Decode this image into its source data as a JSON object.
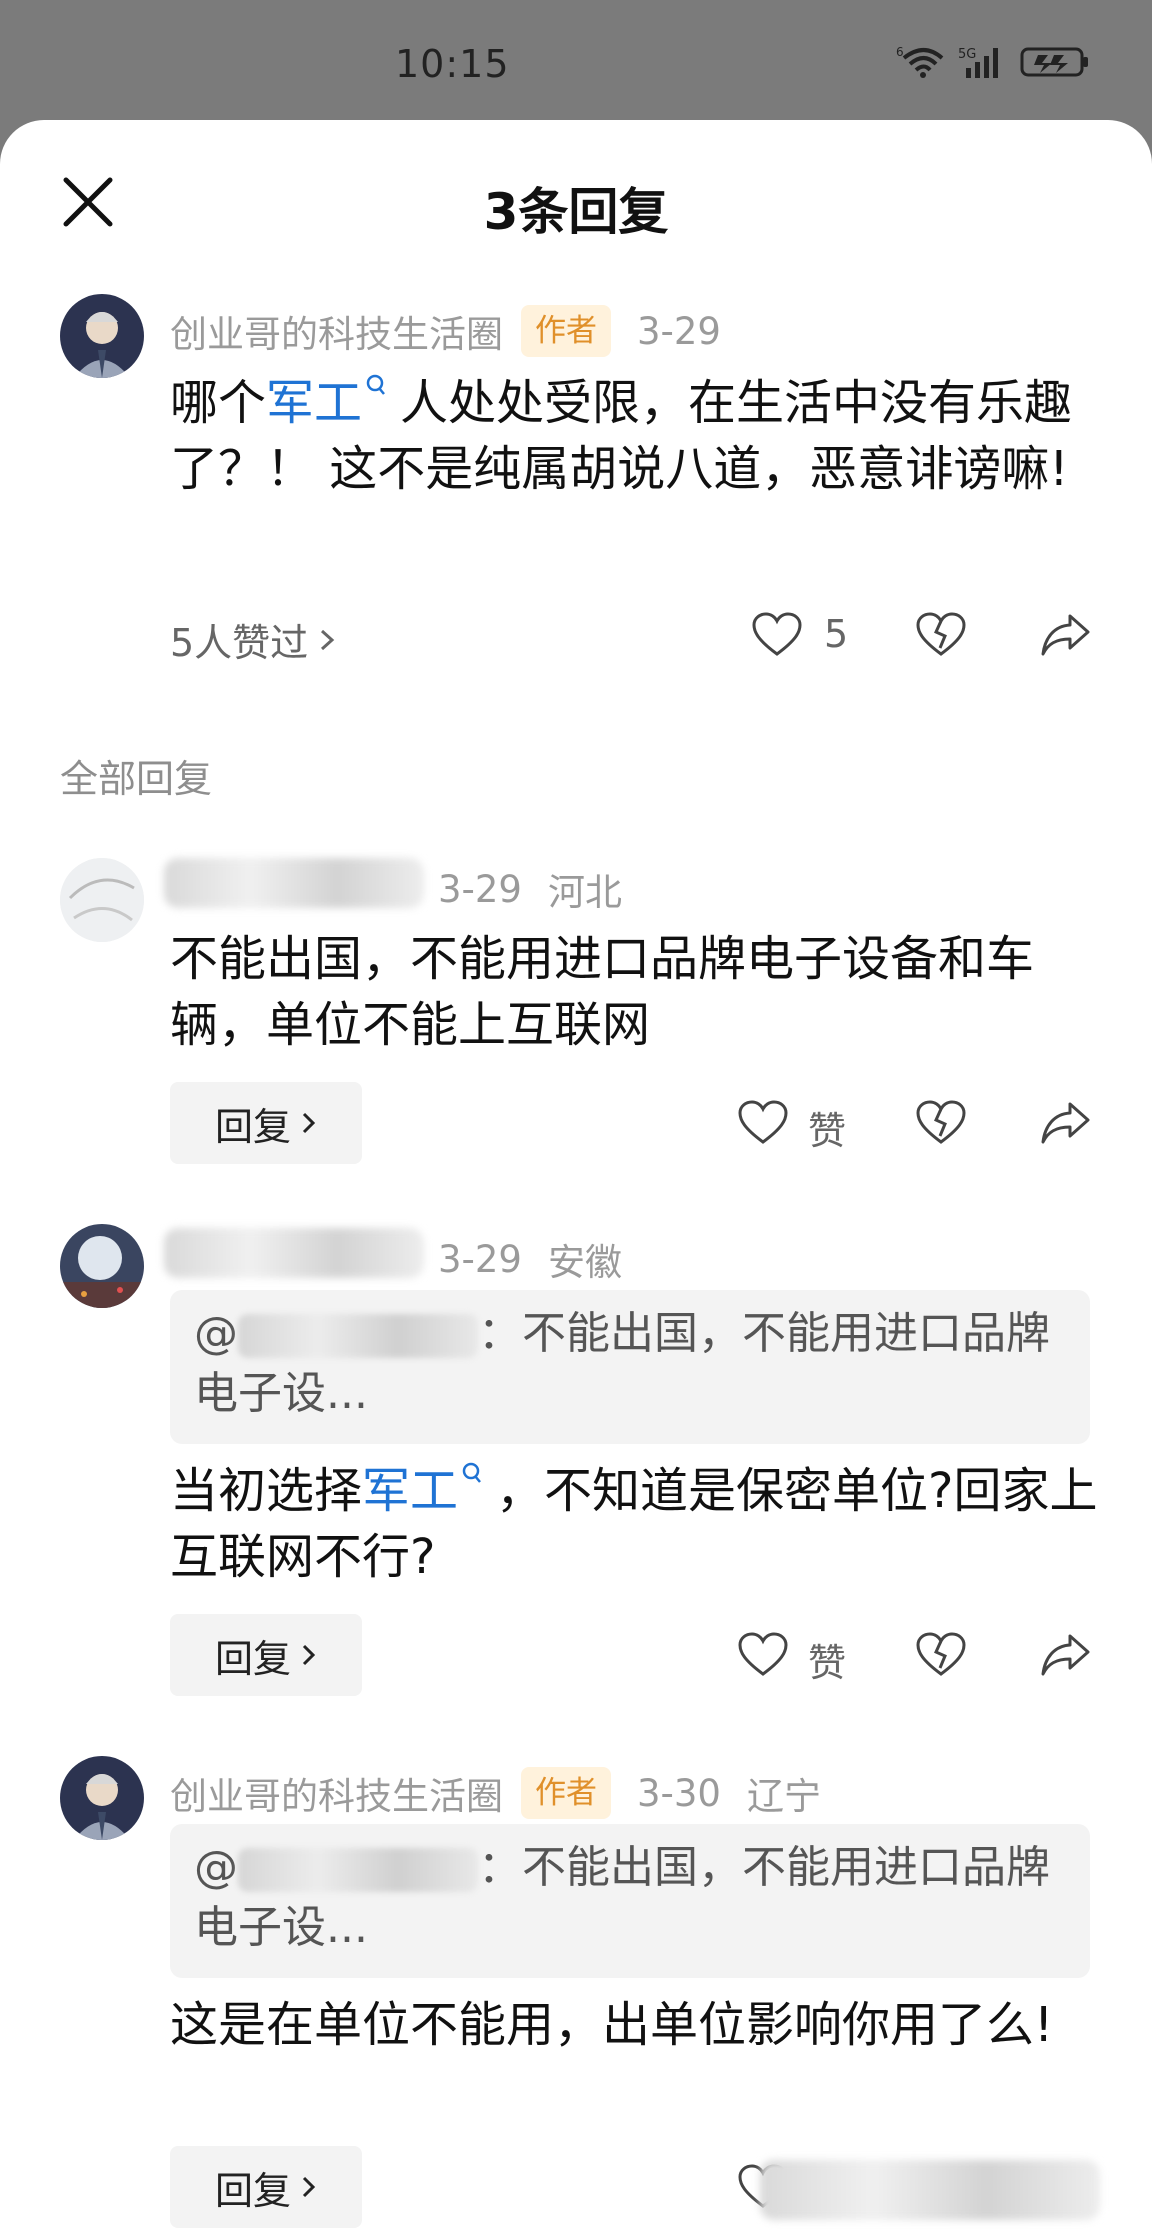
{
  "status_bar": {
    "time": "10:15",
    "network": "5G",
    "wifi_level": "6"
  },
  "header": {
    "title": "3条回复"
  },
  "main_comment": {
    "author": "创业哥的科技生活圈",
    "badge": "作者",
    "date": "3-29",
    "text_1": "哪个",
    "keyword": "军工",
    "text_2": "人处处受限，在生活中没有乐趣了？！ 这不是纯属胡说八道，恶意诽谤嘛!",
    "likers": "5人赞过",
    "like_count": "5"
  },
  "section_label": "全部回复",
  "replies": [
    {
      "date": "3-29",
      "location": "河北",
      "text": "不能出国，不能用进口品牌电子设备和车辆，单位不能上互联网",
      "like_label": "赞",
      "reply_label": "回复"
    },
    {
      "date": "3-29",
      "location": "安徽",
      "quote_prefix": "@",
      "quote_text": "：不能出国，不能用进口品牌电子设...",
      "text_1": "当初选择",
      "keyword": "军工",
      "text_2": "，不知道是保密单位?回家上互联网不行?",
      "like_label": "赞",
      "reply_label": "回复"
    },
    {
      "author": "创业哥的科技生活圈",
      "badge": "作者",
      "date": "3-30",
      "location": "辽宁",
      "quote_prefix": "@",
      "quote_text": "：不能出国，不能用进口品牌电子设...",
      "text": "这是在单位不能用，出单位影响你用了么!",
      "reply_label": "回复"
    }
  ],
  "colors": {
    "accent_link": "#1f73d4",
    "author_badge_bg": "#fff2dc",
    "author_badge_text": "#e0902a",
    "overlay": "#7b7b7b"
  },
  "icons": [
    "close-icon",
    "heart-icon",
    "broken-heart-icon",
    "share-icon",
    "chevron-right-icon",
    "search-icon",
    "wifi-icon",
    "signal-icon",
    "battery-icon"
  ]
}
